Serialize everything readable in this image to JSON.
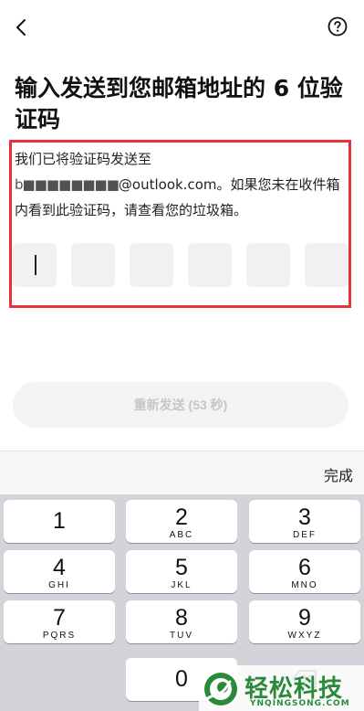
{
  "title": "输入发送到您邮箱地址的 6 位验证码",
  "description": {
    "line1": "我们已将验证码发送至",
    "email_masked": "b■■■■■■■■",
    "email_domain": "@outlook.com",
    "line2_rest": "。如果您未在收件箱内看到此验证码，请查看您的垃圾箱。"
  },
  "code_boxes": 6,
  "resend_label": "重新发送 (53 秒)",
  "keyboard": {
    "done_label": "完成",
    "keys": [
      {
        "digit": "1",
        "letters": ""
      },
      {
        "digit": "2",
        "letters": "ABC"
      },
      {
        "digit": "3",
        "letters": "DEF"
      },
      {
        "digit": "4",
        "letters": "GHI"
      },
      {
        "digit": "5",
        "letters": "JKL"
      },
      {
        "digit": "6",
        "letters": "MNO"
      },
      {
        "digit": "7",
        "letters": "PQRS"
      },
      {
        "digit": "8",
        "letters": "TUV"
      },
      {
        "digit": "9",
        "letters": "WXYZ"
      },
      {
        "digit": "0",
        "letters": ""
      }
    ]
  },
  "watermark": {
    "text": "轻松科技",
    "sub": "YNQINGSONG.COM"
  },
  "colors": {
    "highlight": "#e8303a",
    "watermark_green": "#2a8a3a",
    "keyboard_bg": "#d2d4d9"
  },
  "icons": {
    "back": "chevron-left-icon",
    "help": "question-circle-icon"
  }
}
